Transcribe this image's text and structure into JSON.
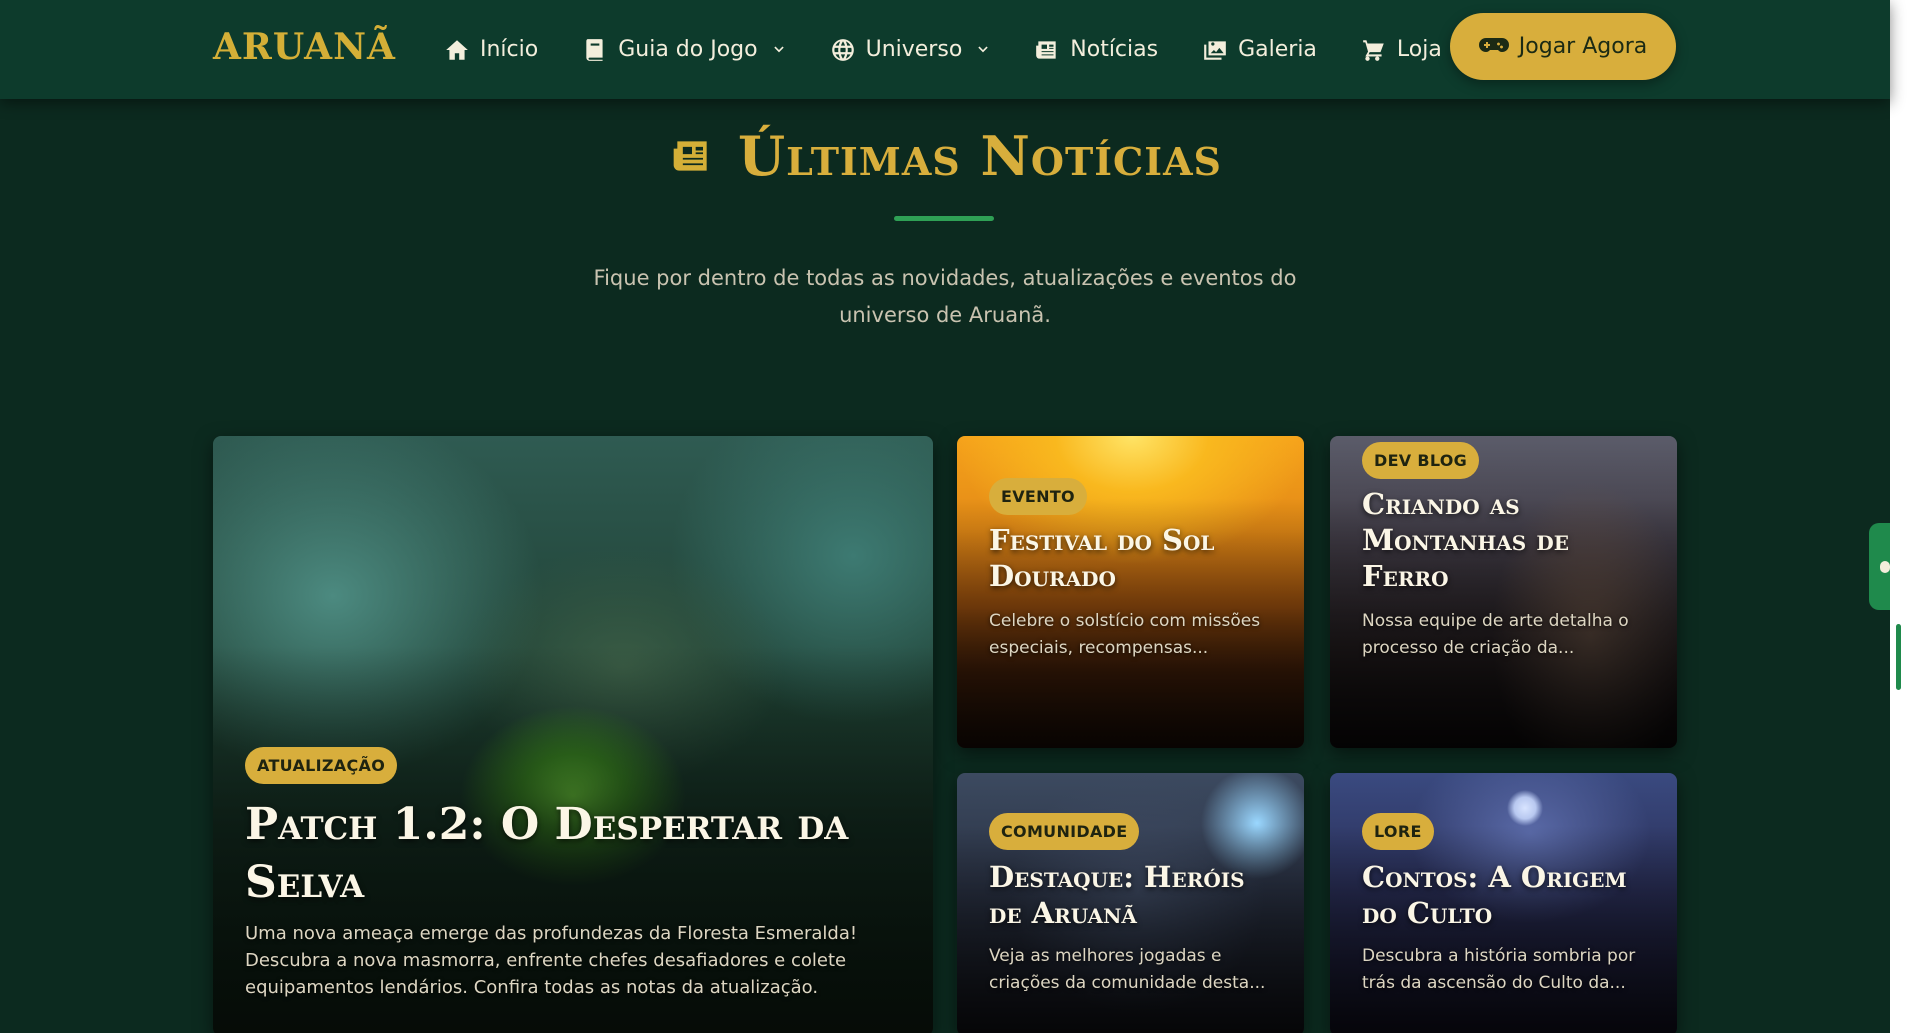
{
  "nav": {
    "logo": "ARUANÃ",
    "items": [
      {
        "label": "Início",
        "icon": "home-icon",
        "dropdown": false
      },
      {
        "label": "Guia do Jogo",
        "icon": "book-icon",
        "dropdown": true
      },
      {
        "label": "Universo",
        "icon": "globe-icon",
        "dropdown": true
      },
      {
        "label": "Notícias",
        "icon": "newspaper-icon",
        "dropdown": false
      },
      {
        "label": "Galeria",
        "icon": "images-icon",
        "dropdown": false
      },
      {
        "label": "Loja",
        "icon": "cart-icon",
        "dropdown": false
      }
    ],
    "cta_label": "Jogar Agora"
  },
  "section": {
    "title": "Últimas Notícias",
    "subtitle": "Fique por dentro de todas as novidades, atualizações e eventos do universo de Aruanã."
  },
  "news": {
    "featured": {
      "badge": "ATUALIZAÇÃO",
      "title": "Patch 1.2: O Despertar da Selva",
      "desc": "Uma nova ameaça emerge das profundezas da Floresta Esmeralda! Descubra a nova masmorra, enfrente chefes desafiadores e colete equipamentos lendários. Confira todas as notas da atualização."
    },
    "cards": [
      {
        "badge": "EVENTO",
        "title": "Festival do Sol Dourado",
        "desc": "Celebre o solstício com missões especiais, recompensas..."
      },
      {
        "badge": "DEV BLOG",
        "title": "Criando as Montanhas de Ferro",
        "desc": "Nossa equipe de arte detalha o processo de criação da..."
      },
      {
        "badge": "COMUNIDADE",
        "title": "Destaque: Heróis de Aruanã",
        "desc": "Veja as melhores jogadas e criações da comunidade desta..."
      },
      {
        "badge": "LORE",
        "title": "Contos: A Origem do Culto",
        "desc": "Descubra a história sombria por trás da ascensão do Culto da..."
      }
    ]
  },
  "colors": {
    "nav_bg": "#0d3b2c",
    "page_bg": "#0c2a1f",
    "gold": "#d8ae3c",
    "green_accent": "#2fa055"
  }
}
